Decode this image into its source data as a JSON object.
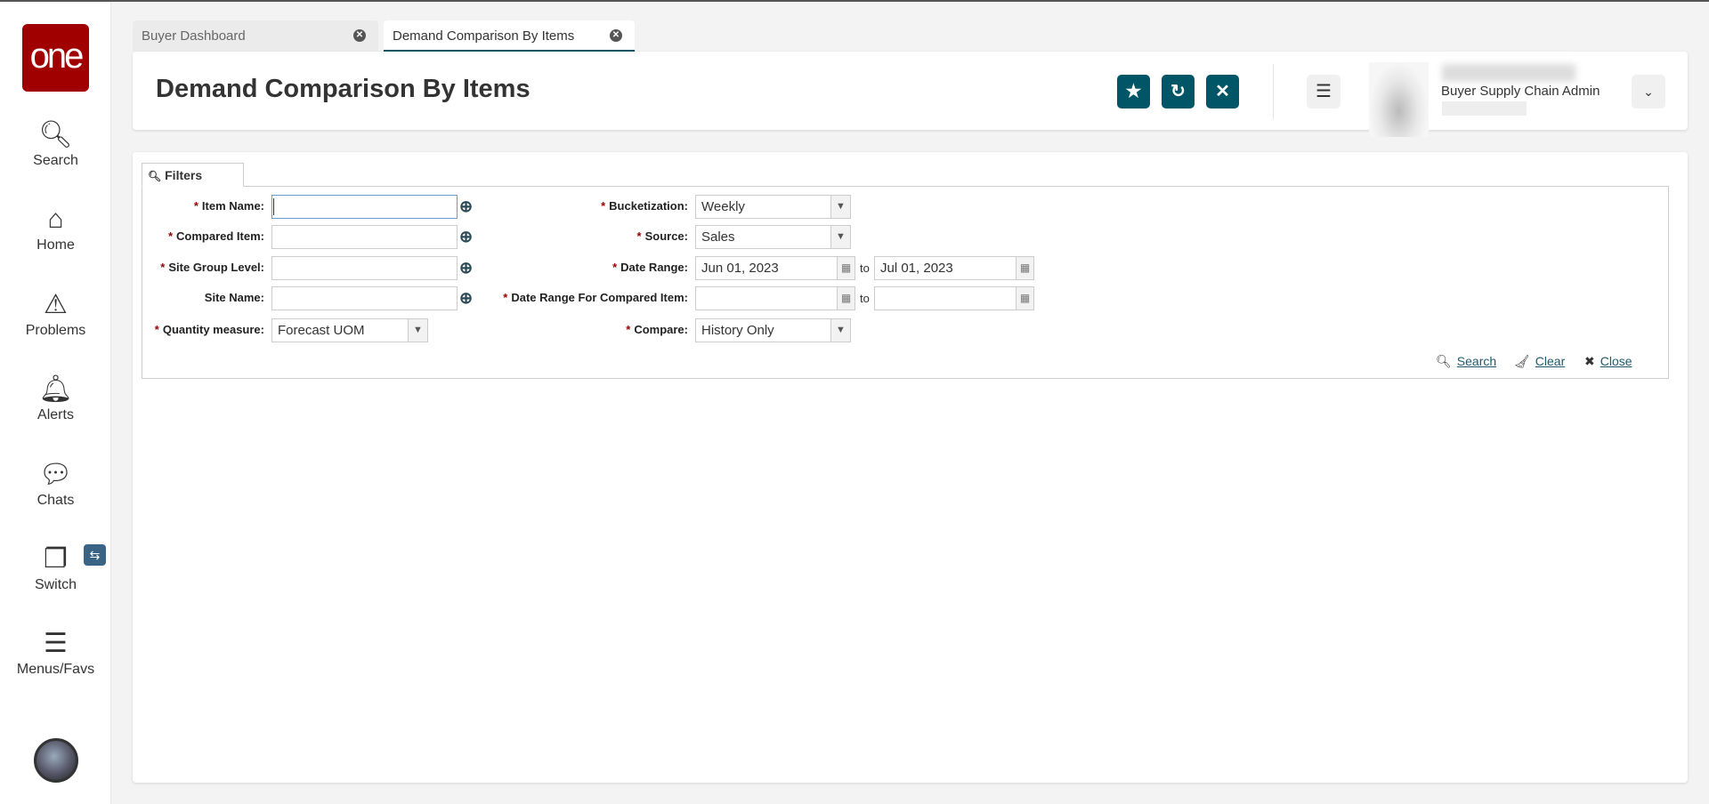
{
  "sidebar": {
    "logo": "one",
    "items": [
      {
        "label": "Search",
        "icon": "search-icon"
      },
      {
        "label": "Home",
        "icon": "home-icon"
      },
      {
        "label": "Problems",
        "icon": "warning-icon"
      },
      {
        "label": "Alerts",
        "icon": "bell-icon"
      },
      {
        "label": "Chats",
        "icon": "chat-icon"
      },
      {
        "label": "Switch",
        "icon": "switch-icon"
      },
      {
        "label": "Menus/Favs",
        "icon": "menu-icon"
      }
    ]
  },
  "tabs": [
    {
      "label": "Buyer Dashboard",
      "active": false
    },
    {
      "label": "Demand Comparison By Items",
      "active": true
    }
  ],
  "header": {
    "title": "Demand Comparison By Items",
    "role": "Buyer Supply Chain Admin"
  },
  "filters": {
    "tab_label": "Filters",
    "item_name": {
      "label": "Item Name:",
      "value": ""
    },
    "compared_item": {
      "label": "Compared Item:",
      "value": ""
    },
    "site_group_level": {
      "label": "Site Group Level:",
      "value": ""
    },
    "site_name": {
      "label": "Site Name:",
      "value": ""
    },
    "quantity_measure": {
      "label": "Quantity measure:",
      "value": "Forecast UOM"
    },
    "bucketization": {
      "label": "Bucketization:",
      "value": "Weekly"
    },
    "source": {
      "label": "Source:",
      "value": "Sales"
    },
    "date_range": {
      "label": "Date Range:",
      "from": "Jun 01, 2023",
      "to": "Jul 01, 2023"
    },
    "date_range_compared": {
      "label": "Date Range For Compared Item:",
      "from": "",
      "to": ""
    },
    "compare": {
      "label": "Compare:",
      "value": "History Only"
    },
    "to_label": "to",
    "required_mark": "*",
    "actions": {
      "search": "Search",
      "clear": "Clear",
      "close": "Close"
    }
  },
  "colors": {
    "brand": "#a00000",
    "accent": "#005566"
  }
}
